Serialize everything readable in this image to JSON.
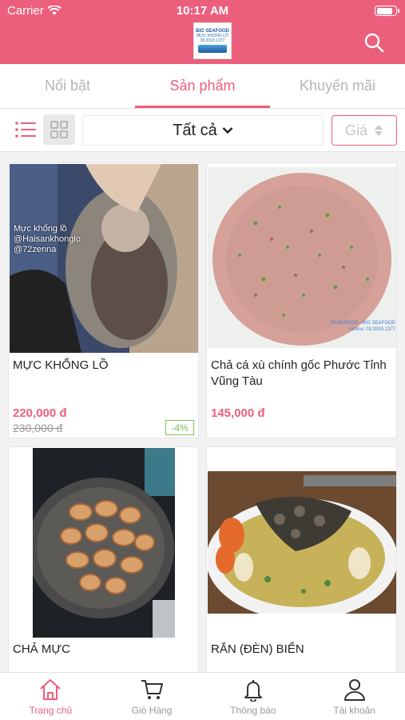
{
  "status": {
    "carrier": "Carrier",
    "time": "10:17 AM",
    "battery_level": 0.9
  },
  "logo": {
    "brand": "BIG SEAFOOD",
    "line1": "MỰC KHỔNG LỒ",
    "phone": "03.3333.1377"
  },
  "tabs": [
    {
      "label": "Nổi bật",
      "active": false
    },
    {
      "label": "Sản phẩm",
      "active": true
    },
    {
      "label": "Khuyến mãi",
      "active": false
    }
  ],
  "filter": {
    "category": "Tất cả",
    "sort_label": "Giá"
  },
  "products": [
    {
      "name": "MỰC KHỔNG LỒ",
      "price": "220,000 đ",
      "old_price": "230,000 đ",
      "discount": "-4%",
      "overlay": "Mực khổng lồ\n@Haisankhonglo\n@72zenna"
    },
    {
      "name": "Chả cá xù chính gốc Phước Tỉnh Vũng Tàu",
      "price": "145,000 đ",
      "overlay": "TH.SANDOO - BIG SEAFOOD\nhotline: 03.3333.1377"
    },
    {
      "name": "CHẢ MỰC"
    },
    {
      "name": "RẮN (ĐÈN) BIỂN"
    }
  ],
  "nav": [
    {
      "label": "Trang chủ",
      "icon": "home-icon",
      "active": true
    },
    {
      "label": "Giỏ Hàng",
      "icon": "cart-icon",
      "active": false
    },
    {
      "label": "Thông báo",
      "icon": "bell-icon",
      "active": false
    },
    {
      "label": "Tài khoản",
      "icon": "user-icon",
      "active": false
    }
  ],
  "colors": {
    "accent": "#ec5f7c",
    "discount": "#7ac25a"
  }
}
